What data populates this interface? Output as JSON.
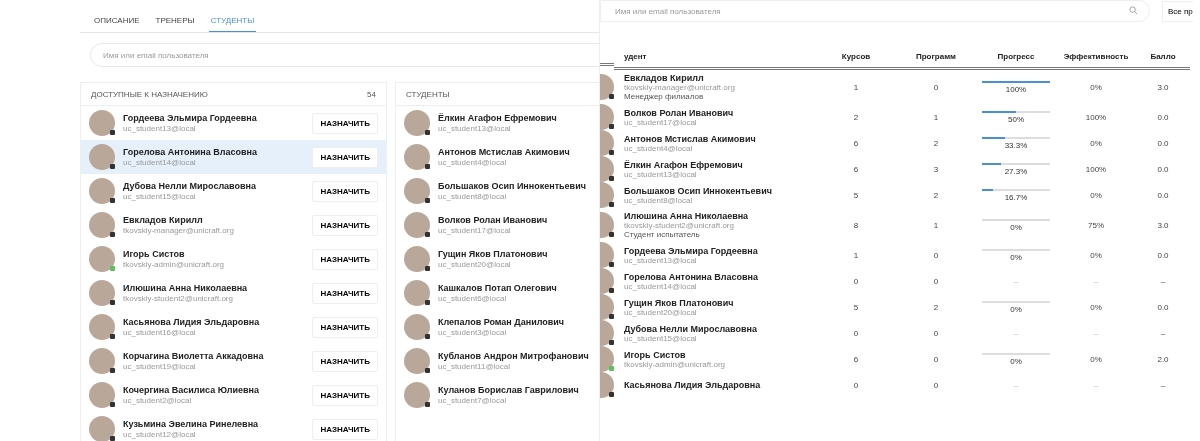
{
  "left": {
    "tabs": [
      {
        "label": "ОПИСАНИЕ",
        "selected": false
      },
      {
        "label": "ТРЕНЕРЫ",
        "selected": false
      },
      {
        "label": "СТУДЕНТЫ",
        "selected": true
      }
    ],
    "search": {
      "placeholder": "Имя или email пользователя"
    },
    "available": {
      "title": "ДОСТУПНЫЕ К НАЗНАЧЕНИЮ",
      "count": "54",
      "rows": [
        {
          "name": "Гордеева Эльмира Гордеевна",
          "email": "uc_student13@local",
          "online": false,
          "selected": false,
          "button": "НАЗНАЧИТЬ"
        },
        {
          "name": "Горелова Антонина Власовна",
          "email": "uc_student14@local",
          "online": false,
          "selected": true,
          "button": "НАЗНАЧИТЬ"
        },
        {
          "name": "Дубова Нелли Мирославовна",
          "email": "uc_student15@local",
          "online": false,
          "selected": false,
          "button": "НАЗНАЧИТЬ"
        },
        {
          "name": "Евкладов Кирилл",
          "email": "tkovskiy-manager@unicraft.org",
          "online": false,
          "selected": false,
          "button": "НАЗНАЧИТЬ"
        },
        {
          "name": "Игорь Систов",
          "email": "tkovskiy-admin@unicraft.org",
          "online": true,
          "selected": false,
          "button": "НАЗНАЧИТЬ"
        },
        {
          "name": "Илюшина Анна Николаевна",
          "email": "tkovskiy-student2@unicraft.org",
          "online": false,
          "selected": false,
          "button": "НАЗНАЧИТЬ"
        },
        {
          "name": "Касьянова Лидия Эльдаровна",
          "email": "uc_student16@local",
          "online": false,
          "selected": false,
          "button": "НАЗНАЧИТЬ"
        },
        {
          "name": "Корчагина Виолетта Аккадовна",
          "email": "uc_student19@local",
          "online": false,
          "selected": false,
          "button": "НАЗНАЧИТЬ"
        },
        {
          "name": "Кочергина Василиса Юлиевна",
          "email": "uc_student2@local",
          "online": false,
          "selected": false,
          "button": "НАЗНАЧИТЬ"
        },
        {
          "name": "Кузьмина Эвелина Ринелевна",
          "email": "uc_student12@local",
          "online": false,
          "selected": false,
          "button": "НАЗНАЧИТЬ"
        }
      ]
    },
    "students": {
      "title": "СТУДЕНТЫ",
      "rows": [
        {
          "name": "Ёлкин Агафон Ефремович",
          "email": "uc_student13@local"
        },
        {
          "name": "Антонов Мстислав Акимович",
          "email": "uc_student4@local"
        },
        {
          "name": "Большаков Осип Иннокентьевич",
          "email": "uc_student8@local"
        },
        {
          "name": "Волков Ролан Иванович",
          "email": "uc_student17@local"
        },
        {
          "name": "Гущин Яков Платонович",
          "email": "uc_student20@local"
        },
        {
          "name": "Кашкалов Потап Олегович",
          "email": "uc_student6@local"
        },
        {
          "name": "Клепалов Роман Данилович",
          "email": "uc_student3@local"
        },
        {
          "name": "Кубланов Андрон Митрофанович",
          "email": "uc_student11@local"
        },
        {
          "name": "Куланов Борислав Гаврилович",
          "email": "uc_student7@local"
        }
      ]
    }
  },
  "right": {
    "search": {
      "placeholder": "Имя или email пользователя"
    },
    "filter_button": "Все пр",
    "table": {
      "columns": [
        "удент",
        "Курсов",
        "Программ",
        "Прогресс",
        "Эффективность",
        "Балло"
      ],
      "rows": [
        {
          "name": "Евкладов Кирилл",
          "email": "tkovskiy-manager@unicraft.org",
          "role": "Менеджер филиалов",
          "online": false,
          "courses": "1",
          "programs": "0",
          "progress": {
            "level": 1,
            "label": "100%"
          },
          "efficiency": "0%",
          "score": "3.0"
        },
        {
          "name": "Волков Ролан Иванович",
          "email": "uc_student17@local",
          "online": false,
          "courses": "2",
          "programs": "1",
          "progress": {
            "level": 0.5,
            "label": "50%"
          },
          "efficiency": "100%",
          "score": "0.0"
        },
        {
          "name": "Антонов Мстислав Акимович",
          "email": "uc_student4@local",
          "online": false,
          "courses": "6",
          "programs": "2",
          "progress": {
            "level": 0.333,
            "label": "33.3%"
          },
          "efficiency": "0%",
          "score": "0.0"
        },
        {
          "name": "Ёлкин Агафон Ефремович",
          "email": "uc_student13@local",
          "online": false,
          "courses": "6",
          "programs": "3",
          "progress": {
            "level": 0.273,
            "label": "27.3%"
          },
          "efficiency": "100%",
          "score": "0.0"
        },
        {
          "name": "Большаков Осип Иннокентьевич",
          "email": "uc_student8@local",
          "online": false,
          "courses": "5",
          "programs": "2",
          "progress": {
            "level": 0.167,
            "label": "16.7%"
          },
          "efficiency": "0%",
          "score": "0.0"
        },
        {
          "name": "Илюшина Анна Николаевна",
          "email": "tkovskiy-student2@unicraft.org",
          "role": "Студент испытатель",
          "online": false,
          "courses": "8",
          "programs": "1",
          "progress": {
            "level": 0,
            "label": "0%"
          },
          "efficiency": "75%",
          "score": "3.0"
        },
        {
          "name": "Гордеева Эльмира Гордеевна",
          "email": "uc_student13@local",
          "online": false,
          "courses": "1",
          "programs": "0",
          "progress": {
            "level": 0,
            "label": "0%"
          },
          "efficiency": "0%",
          "score": "0.0"
        },
        {
          "name": "Горелова Антонина Власовна",
          "email": "uc_student14@local",
          "online": false,
          "courses": "0",
          "programs": "0",
          "progress": {
            "label": "–"
          },
          "efficiency": "–",
          "score": "–"
        },
        {
          "name": "Гущин Яков Платонович",
          "email": "uc_student20@local",
          "online": false,
          "courses": "5",
          "programs": "2",
          "progress": {
            "level": 0,
            "label": "0%"
          },
          "efficiency": "0%",
          "score": "0.0"
        },
        {
          "name": "Дубова Нелли Мирославовна",
          "email": "uc_student15@local",
          "online": false,
          "courses": "0",
          "programs": "0",
          "progress": {
            "label": "–"
          },
          "efficiency": "–",
          "score": "–"
        },
        {
          "name": "Игорь Систов",
          "email": "tkovskiy-admin@unicraft.org",
          "online": true,
          "courses": "6",
          "programs": "0",
          "progress": {
            "level": 0,
            "label": "0%"
          },
          "efficiency": "0%",
          "score": "2.0"
        },
        {
          "name": "Касьянова Лидия Эльдаровна",
          "online": false,
          "courses": "0",
          "programs": "0",
          "progress": {
            "label": "–"
          },
          "efficiency": "–",
          "score": "–"
        }
      ]
    }
  }
}
